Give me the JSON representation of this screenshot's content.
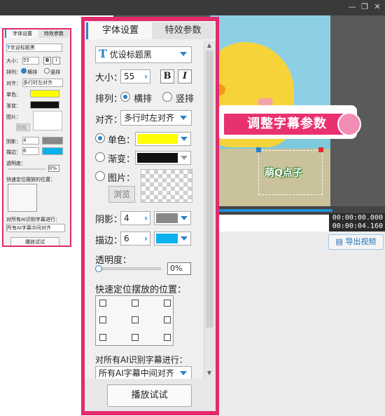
{
  "window": {
    "minimize_icon": "minimize-icon",
    "restore_icon": "restore-icon",
    "close_icon": "close-icon"
  },
  "preview": {
    "title_text": "调整字幕参数",
    "subtitle_text": "萌Q点子",
    "timecode_current": "00:00:00.000",
    "timecode_total": "00:00:04.160",
    "export_label": "导出视频",
    "playback_progress": 0.7
  },
  "panel": {
    "tabs": [
      {
        "label": "字体设置",
        "active": true
      },
      {
        "label": "特效参数",
        "active": false
      }
    ],
    "font": {
      "icon": "T",
      "value": "优设标题黑"
    },
    "size": {
      "label": "大小：",
      "value": "55",
      "bold": "B",
      "italic": "I"
    },
    "arrange": {
      "label": "排列：",
      "horizontal": "横排",
      "vertical": "竖排",
      "selected": "horizontal"
    },
    "align": {
      "label": "对齐：",
      "value": "多行时左对齐"
    },
    "fill": {
      "solid_label": "单色：",
      "solid_color": "#FFFF00",
      "gradient_label": "渐变：",
      "gradient_color": "#111111",
      "image_label": "图片：",
      "browse_label": "浏览",
      "selected": "solid"
    },
    "shadow": {
      "label": "阴影：",
      "value": "4",
      "color": "#888888"
    },
    "stroke": {
      "label": "描边：",
      "value": "6",
      "color": "#0CB2EE"
    },
    "opacity": {
      "label": "透明度：",
      "value": "0%",
      "level": 0
    },
    "position": {
      "label": "快速定位摆放的位置："
    },
    "ai": {
      "label": "对所有AI识别字幕进行：",
      "value": "所有AI字幕中间对齐"
    },
    "play_label": "播放试试"
  }
}
